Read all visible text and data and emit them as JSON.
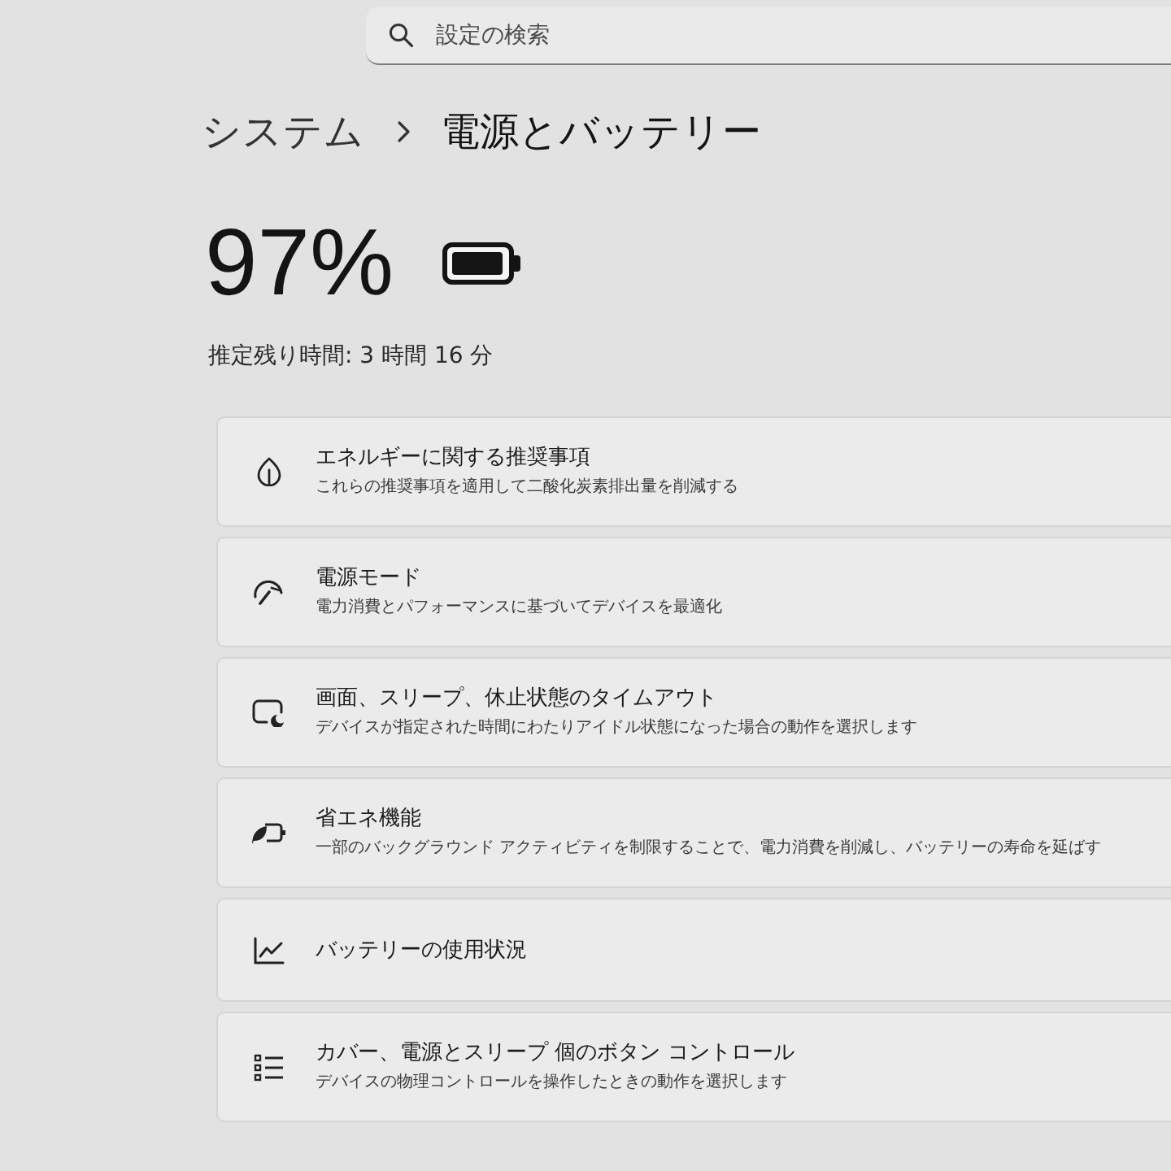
{
  "search": {
    "placeholder": "設定の検索"
  },
  "breadcrumb": {
    "parent": "システム",
    "current": "電源とバッテリー"
  },
  "battery": {
    "percent": "97%",
    "level": 0.97,
    "remaining": "推定残り時間: 3 時間 16 分"
  },
  "cards": [
    {
      "title": "エネルギーに関する推奨事項",
      "description": "これらの推奨事項を適用して二酸化炭素排出量を削減する"
    },
    {
      "title": "電源モード",
      "description": "電力消費とパフォーマンスに基づいてデバイスを最適化"
    },
    {
      "title": "画面、スリープ、休止状態のタイムアウト",
      "description": "デバイスが指定された時間にわたりアイドル状態になった場合の動作を選択します"
    },
    {
      "title": "省エネ機能",
      "description": "一部のバックグラウンド アクティビティを制限することで、電力消費を削減し、バッテリーの寿命を延ばす"
    },
    {
      "title": "バッテリーの使用状況"
    },
    {
      "title": "カバー、電源とスリープ 個のボタン コントロール",
      "description": "デバイスの物理コントロールを操作したときの動作を選択します"
    }
  ]
}
